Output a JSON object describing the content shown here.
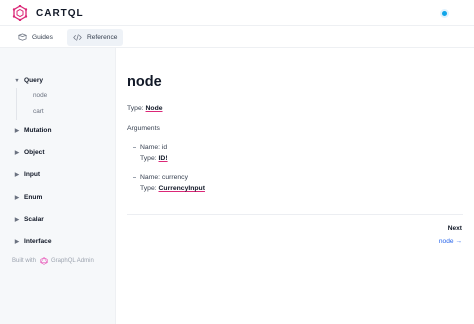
{
  "app": {
    "name": "CARTQL"
  },
  "tabs": [
    {
      "label": "Guides",
      "icon": "book-icon"
    },
    {
      "label": "Reference",
      "icon": "code-icon"
    }
  ],
  "sidebar": {
    "groups": [
      {
        "label": "Query",
        "expanded": true,
        "items": [
          "node",
          "cart"
        ]
      },
      {
        "label": "Mutation",
        "expanded": false
      },
      {
        "label": "Object",
        "expanded": false
      },
      {
        "label": "Input",
        "expanded": false
      },
      {
        "label": "Enum",
        "expanded": false
      },
      {
        "label": "Scalar",
        "expanded": false
      },
      {
        "label": "Interface",
        "expanded": false
      }
    ],
    "footer": {
      "prefix": "Built with",
      "brand": "GraphQL Admin"
    }
  },
  "main": {
    "title": "node",
    "type_label": "Type:",
    "type_value": "Node",
    "arguments_label": "Arguments",
    "arguments": [
      {
        "name_label": "Name:",
        "name": "id",
        "type_label": "Type:",
        "type": "ID!"
      },
      {
        "name_label": "Name:",
        "name": "currency",
        "type_label": "Type:",
        "type": "CurrencyInput"
      }
    ],
    "next": {
      "label": "Next",
      "link": "node →"
    }
  },
  "colors": {
    "brand": "#db2777",
    "accent": "#2563eb",
    "sidebar_bg": "#f6f8fa"
  }
}
